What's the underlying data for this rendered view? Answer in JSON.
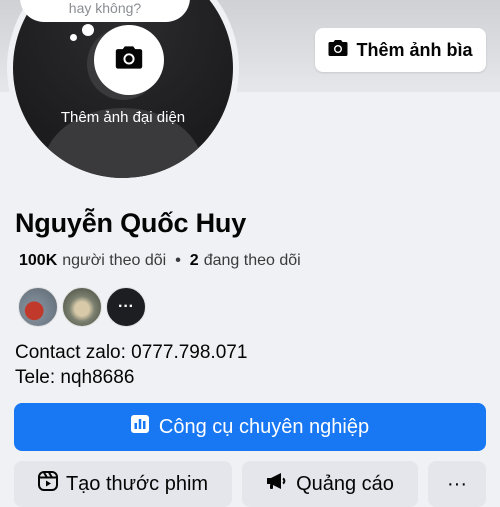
{
  "cover": {
    "add_cover_label": "Thêm ảnh bìa"
  },
  "avatar": {
    "add_avatar_label": "Thêm ảnh đại diện",
    "bubble_text": "hay không?"
  },
  "profile": {
    "name": "Nguyễn Quốc Huy",
    "followers_count": "100K",
    "followers_label": "người theo dõi",
    "separator": "•",
    "following_count": "2",
    "following_label": "đang theo dõi",
    "more_friends_label": "···"
  },
  "bio": {
    "line1": "Contact zalo: 0777.798.071",
    "line2": "Tele: nqh8686"
  },
  "actions": {
    "pro_tools_label": "Công cụ chuyên nghiệp",
    "create_reel_label": "Tạo thước phim",
    "ads_label": "Quảng cáo",
    "more_label": "···"
  },
  "colors": {
    "primary": "#1877f2",
    "secondary_btn": "#e4e6eb",
    "background": "#f0f1f4"
  },
  "icons": [
    "camera-icon",
    "chart-icon",
    "reel-icon",
    "megaphone-icon",
    "more-icon"
  ]
}
